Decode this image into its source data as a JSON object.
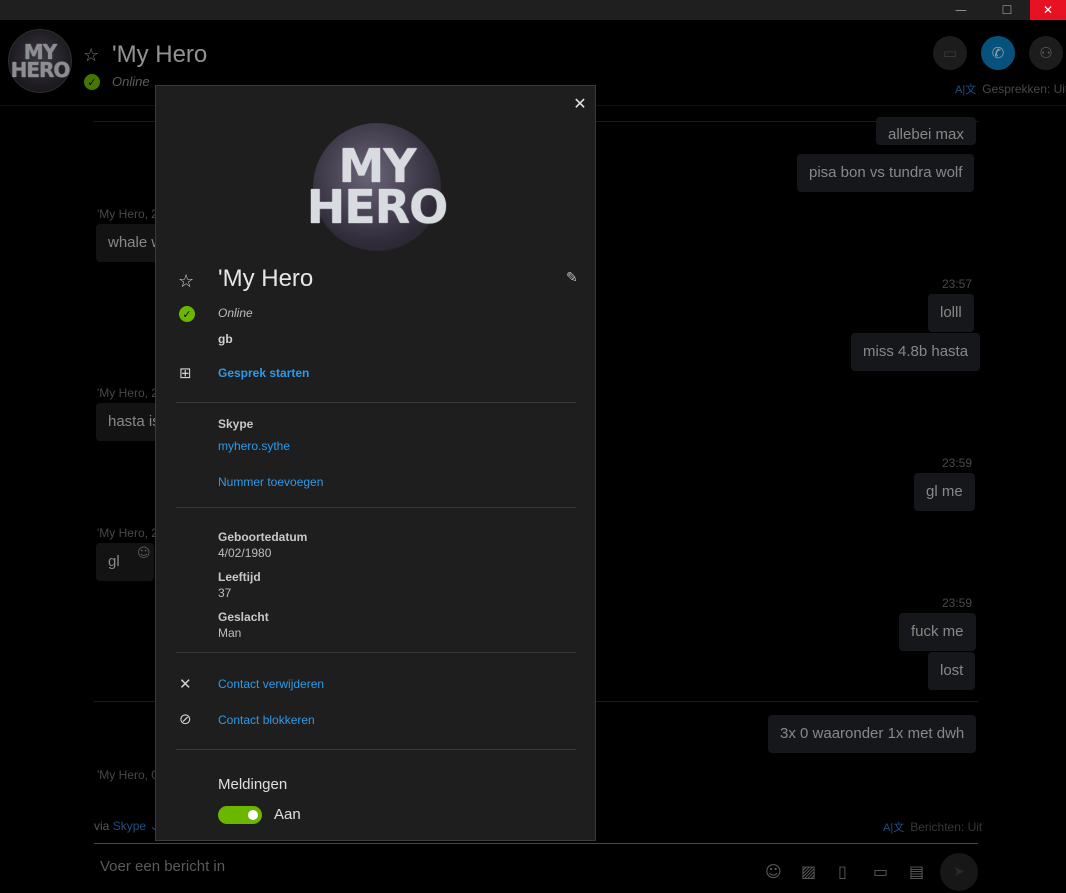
{
  "window": {
    "min_glyph": "—",
    "max_glyph": "☐",
    "close_glyph": "✕"
  },
  "header": {
    "avatar_lines": [
      "MY",
      "HERO"
    ],
    "name": "'My Hero",
    "status": "Online",
    "translate_icon": "A|文",
    "translate_label": "Gesprekken: Uit",
    "icons": {
      "star": "star-icon",
      "video": "video-icon",
      "call": "phone-icon",
      "add": "add-person-icon"
    }
  },
  "chat": {
    "outgoing": [
      {
        "text": "allebei max"
      },
      {
        "text": "pisa bon vs tundra wolf"
      },
      {
        "time": "23:57"
      },
      {
        "text": "lolll"
      },
      {
        "text": "miss 4.8b hasta"
      },
      {
        "time": "23:59"
      },
      {
        "text": "gl me"
      },
      {
        "time": "23:59"
      },
      {
        "text": "fuck me"
      },
      {
        "text": "lost"
      },
      {
        "text": "3x 0 waaronder 1x met dwh"
      }
    ],
    "incoming": [
      {
        "sender": "'My Hero, 2",
        "text": "whale w"
      },
      {
        "sender": "'My Hero, 2",
        "text": "hasta is"
      },
      {
        "sender": "'My Hero, 2",
        "text": "gl"
      },
      {
        "sender": "'My Hero, 0",
        "text": ""
      }
    ]
  },
  "composer": {
    "via": "via",
    "via_link": "Skype ⌄",
    "translate_icon": "A|文",
    "translate_label": "Berichten: Uit",
    "placeholder": "Voer een bericht in"
  },
  "profile": {
    "avatar_lines": [
      "MY",
      "HERO"
    ],
    "name": "'My Hero",
    "status": "Online",
    "mood": "gb",
    "start_chat": "Gesprek starten",
    "skype_label": "Skype",
    "skype_id": "myhero.sythe",
    "add_number": "Nummer toevoegen",
    "birthday_label": "Geboortedatum",
    "birthday": "4/02/1980",
    "age_label": "Leeftijd",
    "age": "37",
    "gender_label": "Geslacht",
    "gender": "Man",
    "remove_contact": "Contact verwijderen",
    "block_contact": "Contact blokkeren",
    "notifications_label": "Meldingen",
    "notifications_state": "Aan"
  },
  "colors": {
    "accent": "#2c9ae8",
    "online": "#6bb700",
    "call": "#0b7fc1",
    "close": "#e81123"
  }
}
